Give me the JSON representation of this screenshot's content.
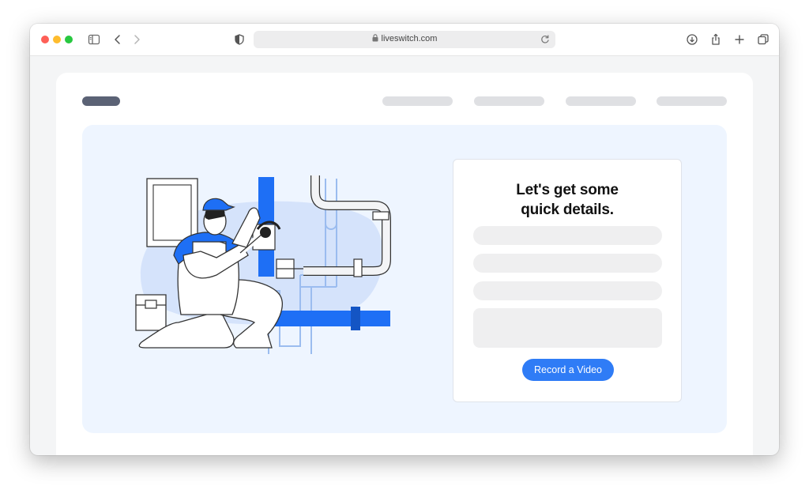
{
  "browser": {
    "url": "liveswitch.com"
  },
  "form": {
    "title_line1": "Let's get some",
    "title_line2": "quick details.",
    "button_label": "Record a Video"
  },
  "colors": {
    "accent": "#2f7cf6",
    "hero_background": "#eef5ff",
    "logo_placeholder": "#5b6275",
    "placeholder_bar": "#dfe0e3",
    "field_background": "#efeff0"
  }
}
